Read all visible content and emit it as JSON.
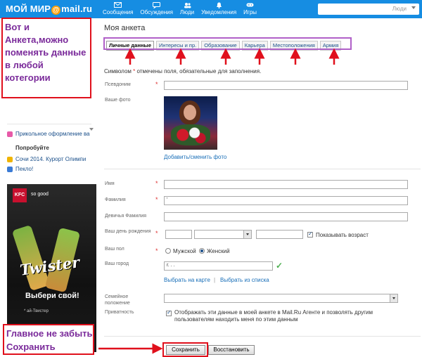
{
  "header": {
    "logo_text": "МОЙ МИР",
    "logo_at": "@",
    "logo_domain": "mail.ru",
    "nav": [
      {
        "label": "Сообщения",
        "icon": "envelope-icon"
      },
      {
        "label": "Обсуждения",
        "icon": "chat-icon"
      },
      {
        "label": "Люди",
        "icon": "people-icon"
      },
      {
        "label": "Уведомления",
        "icon": "bell-icon"
      },
      {
        "label": "Игры",
        "icon": "gamepad-icon"
      }
    ],
    "search_placeholder": "Люди"
  },
  "sidebar": {
    "links": [
      {
        "label": "Прикольное оформление ва",
        "icon": "heart-icon"
      },
      {
        "label": "Сочи 2014. Курорт Олимпи",
        "icon": "olympic-icon"
      },
      {
        "label": "Пекло!",
        "icon": "smiley-icon"
      }
    ],
    "bold_item": "Попробуйте",
    "ad": {
      "brand": "KFC",
      "tagline": "so good",
      "product": "Twister",
      "cta": "Выбери свой!",
      "fine_print": "* ай-Твистер"
    }
  },
  "page": {
    "title": "Моя анкета",
    "tabs": [
      "Личные данные",
      "Интересы и пр.",
      "Образование",
      "Карьера",
      "Местоположения",
      "Армия"
    ],
    "required_hint_prefix": "Символом ",
    "required_hint_star": "*",
    "required_hint_suffix": " отмечены поля, обязательные для заполнения.",
    "labels": {
      "nickname": "Псевдоним",
      "photo": "Ваше фото",
      "first_name": "Имя",
      "last_name": "Фамилия",
      "maiden_name": "Девичья Фамилия",
      "birthday": "Ваш день рождения",
      "gender": "Ваш пол",
      "city": "Ваш город",
      "marital": "Семейное положение",
      "privacy": "Приватность"
    },
    "change_photo_link": "Добавить/сменить фото",
    "show_age_label": "Показывать возраст",
    "gender_male": "Мужской",
    "gender_female": "Женский",
    "city_value": "г. . .",
    "last_name_value": "'",
    "map_link": "Выбрать на карте",
    "link_sep": "|",
    "list_link": "Выбрать из списка",
    "privacy_text": "Отображать эти данные в моей анкете в Mail.Ru Агенте и позволять другим пользователям находить меня по этим данным",
    "save_button": "Сохранить",
    "restore_button": "Восстановить"
  },
  "annotations": {
    "top_note": "Вот и Анкета,можно поменять данные в любой котегории",
    "bottom_note": "Главное не забыть Сохранить",
    "color": "#e0101c",
    "text_color": "#7a2a9a",
    "tabs_outline_color": "#b060c8"
  },
  "colors": {
    "header_bg": "#168de2",
    "link": "#1a6fb8",
    "required": "#d33"
  }
}
